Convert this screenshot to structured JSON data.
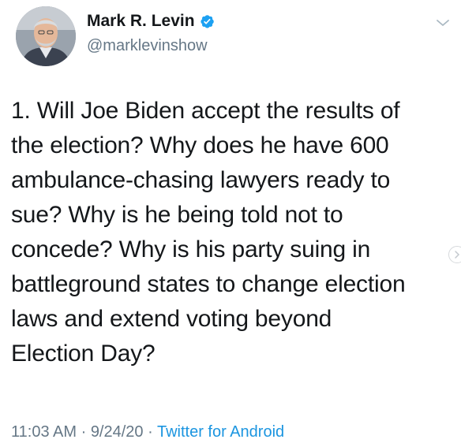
{
  "user": {
    "display_name": "Mark R. Levin",
    "handle": "@marklevinshow",
    "verified": true,
    "avatar_icon": "profile-photo"
  },
  "tweet": {
    "lines": [
      "1. Will Joe Biden accept the results of",
      "the election? Why does he have 600",
      "ambulance-chasing lawyers ready to",
      "sue?  Why is he being told not to",
      "concede?  Why is his party suing in",
      "battleground states to change election",
      "laws and extend voting beyond",
      "Election Day?"
    ],
    "time": "11:03 AM",
    "date": "9/24/20",
    "separator": " · ",
    "source": "Twitter for Android"
  },
  "icons": {
    "caret": "chevron-down-icon",
    "verified": "verified-badge-icon",
    "side_nav": "chevron-right-icon"
  },
  "colors": {
    "text": "#14171a",
    "secondary": "#657786",
    "link": "#1b95e0",
    "verified": "#1da1f2"
  }
}
